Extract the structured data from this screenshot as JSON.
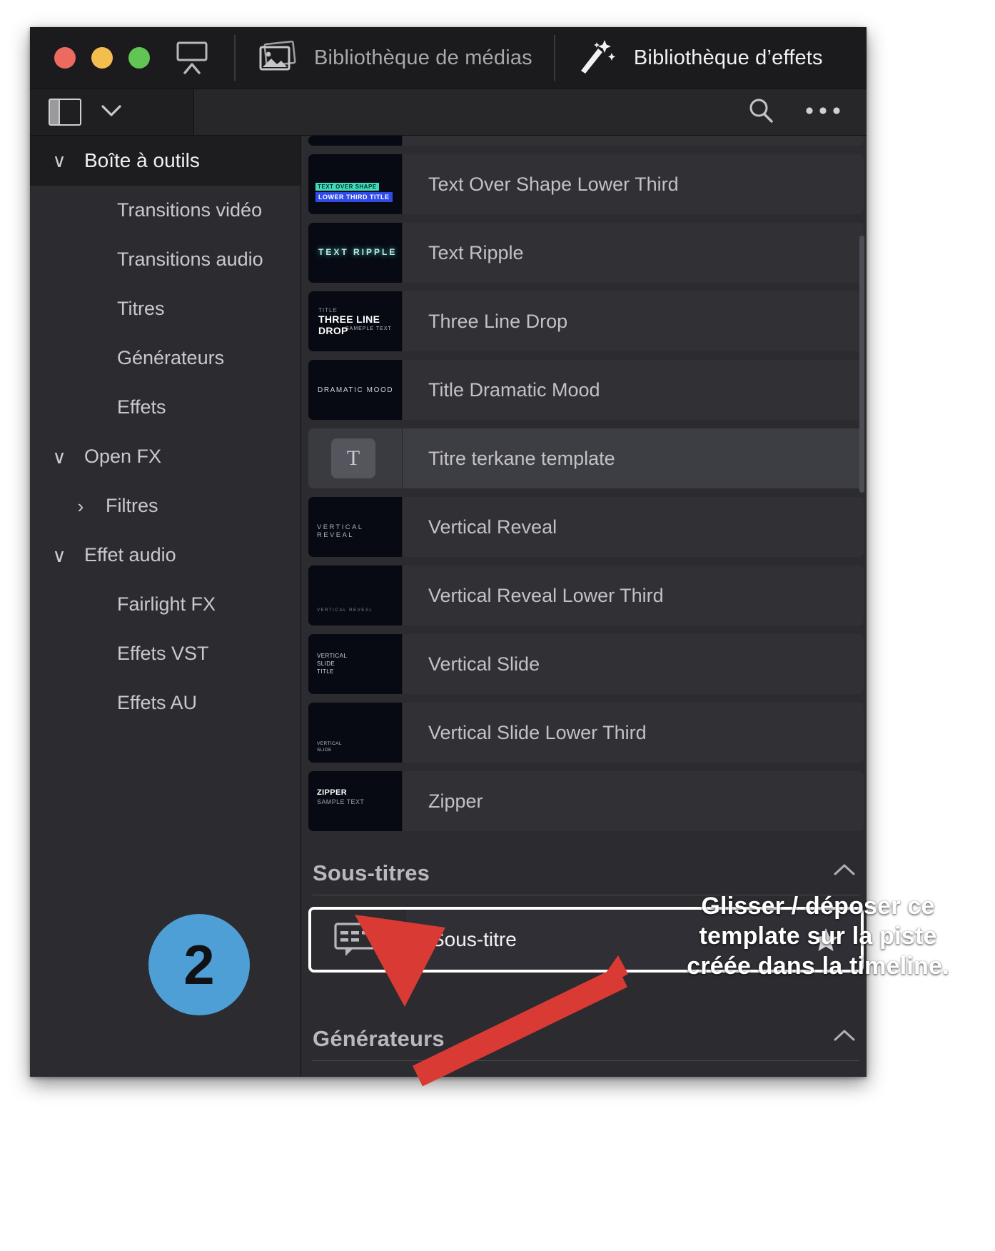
{
  "window": {
    "traffic_lights": [
      "close",
      "minimize",
      "zoom"
    ],
    "toolbar": {
      "view_icon": "monitor-collapse-icon",
      "tabs": [
        {
          "icon": "media-library-icon",
          "label": "Bibliothèque de médias",
          "active": false
        },
        {
          "icon": "effects-wand-icon",
          "label": "Bibliothèque d’effets",
          "active": true
        }
      ]
    },
    "subbar": {
      "panel_toggle_icon": "side-panel-icon",
      "dropdown_icon": "chevron-down-icon",
      "search_icon": "search-icon",
      "more_icon": "more-options-icon",
      "search_placeholder": ""
    }
  },
  "sidebar": {
    "items": [
      {
        "label": "Boîte à outils",
        "type": "group",
        "chevron": "∨",
        "indent": 0,
        "selected": true
      },
      {
        "label": "Transitions vidéo",
        "type": "item",
        "chevron": "",
        "indent": 1,
        "selected": false
      },
      {
        "label": "Transitions audio",
        "type": "item",
        "chevron": "",
        "indent": 1,
        "selected": false
      },
      {
        "label": "Titres",
        "type": "item",
        "chevron": "",
        "indent": 1,
        "selected": false
      },
      {
        "label": "Générateurs",
        "type": "item",
        "chevron": "",
        "indent": 1,
        "selected": false
      },
      {
        "label": "Effets",
        "type": "item",
        "chevron": "",
        "indent": 1,
        "selected": false
      },
      {
        "label": "Open FX",
        "type": "group",
        "chevron": "∨",
        "indent": 0,
        "selected": false
      },
      {
        "label": "Filtres",
        "type": "item",
        "chevron": "›",
        "indent": 2,
        "selected": false
      },
      {
        "label": "Effet audio",
        "type": "group",
        "chevron": "∨",
        "indent": 0,
        "selected": false
      },
      {
        "label": "Fairlight FX",
        "type": "item",
        "chevron": "",
        "indent": 1,
        "selected": false
      },
      {
        "label": "Effets VST",
        "type": "item",
        "chevron": "",
        "indent": 1,
        "selected": false
      },
      {
        "label": "Effets AU",
        "type": "item",
        "chevron": "",
        "indent": 1,
        "selected": false
      }
    ]
  },
  "main": {
    "titles_list": [
      {
        "label": "Text Over Shape Lower Third",
        "thumb_kind": "text-over-shape",
        "thumb_lines": [
          "TEXT OVER SHAPE",
          "LOWER THIRD TITLE"
        ],
        "state": "normal"
      },
      {
        "label": "Text Ripple",
        "thumb_kind": "text-ripple",
        "thumb_lines": [
          "TEXT RIPPLE"
        ],
        "state": "normal"
      },
      {
        "label": "Three Line Drop",
        "thumb_kind": "three-line-drop",
        "thumb_lines": [
          "TITLE",
          "THREE LINE DROP",
          "SAMEPLE  TEXT"
        ],
        "state": "normal"
      },
      {
        "label": "Title Dramatic Mood",
        "thumb_kind": "dramatic-mood",
        "thumb_lines": [
          "DRAMATIC MOOD"
        ],
        "state": "normal"
      },
      {
        "label": "Titre terkane template",
        "thumb_kind": "text-tool-glyph",
        "thumb_lines": [
          "T"
        ],
        "state": "hover"
      },
      {
        "label": "Vertical Reveal",
        "thumb_kind": "vertical-reveal",
        "thumb_lines": [
          "VERTICAL REVEAL"
        ],
        "state": "normal"
      },
      {
        "label": "Vertical Reveal Lower Third",
        "thumb_kind": "vertical-reveal-lower-third",
        "thumb_lines": [
          "VERTICAL REVEAL"
        ],
        "state": "normal"
      },
      {
        "label": "Vertical Slide",
        "thumb_kind": "vertical-slide",
        "thumb_lines": [
          "VERTICAL",
          "SLIDE",
          "TITLE"
        ],
        "state": "normal"
      },
      {
        "label": "Vertical Slide Lower Third",
        "thumb_kind": "vertical-slide-lower-third",
        "thumb_lines": [
          "VERTICAL",
          "SLIDE"
        ],
        "state": "normal"
      },
      {
        "label": "Zipper",
        "thumb_kind": "zipper",
        "thumb_lines": [
          "ZIPPER",
          "SAMPLE TEXT"
        ],
        "state": "normal"
      }
    ],
    "sections": [
      {
        "title": "Sous-titres",
        "chevron": "⌃",
        "collapsed": false
      },
      {
        "title": "Générateurs",
        "chevron": "⌃",
        "collapsed": true
      }
    ],
    "subtitle_item": {
      "label": "Sous-titre",
      "thumb_kind": "closed-caption-icon",
      "favorite_icon": "star-icon",
      "selected": true
    }
  },
  "annotation": {
    "badge_number": "2",
    "badge_color": "#4d9fd6",
    "arrow_color": "#d93a34",
    "text_lines": [
      "Glisser / déposer ce",
      "template sur la piste",
      "créée dans la timeline."
    ]
  }
}
